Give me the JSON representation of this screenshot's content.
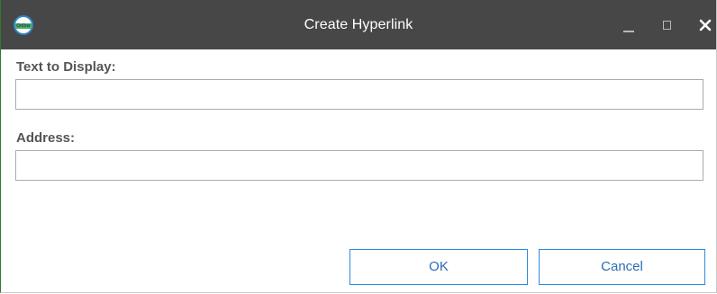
{
  "window": {
    "title": "Create Hyperlink",
    "logo_text": "Online",
    "controls": [
      "minimize-icon",
      "maximize-icon",
      "close-icon"
    ]
  },
  "form": {
    "display_label": "Text to Display:",
    "display_value": "",
    "address_label": "Address:",
    "address_value": ""
  },
  "buttons": {
    "ok_label": "OK",
    "cancel_label": "Cancel"
  },
  "colors": {
    "titlebar": "#474747",
    "button_border": "#2b8be0",
    "button_text": "#2a6db5"
  }
}
